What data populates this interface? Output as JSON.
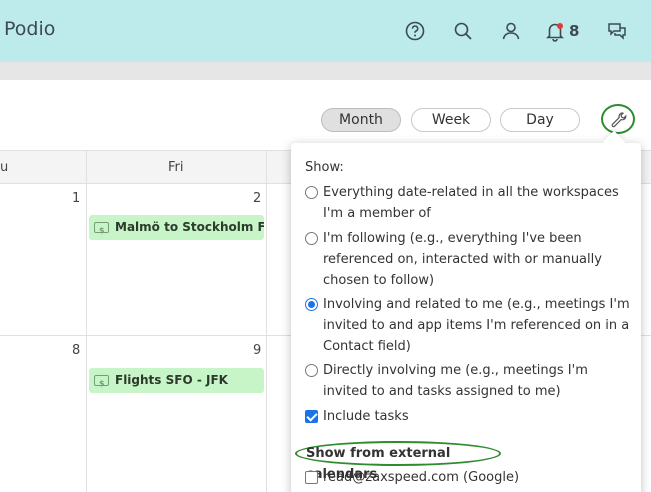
{
  "app": {
    "brand": "Podio"
  },
  "topbar": {
    "icons": [
      "help-icon",
      "search-icon",
      "profile-icon",
      "bell-icon",
      "chat-icon"
    ],
    "notification_count": "8"
  },
  "views": {
    "month": "Month",
    "week": "Week",
    "day": "Day",
    "active": "Month"
  },
  "calendar": {
    "days": [
      "u",
      "Fri"
    ],
    "week1": {
      "thu_date": "1",
      "fri_date": "2",
      "event": "Malmö to Stockholm Fligh"
    },
    "week2": {
      "thu_date": "8",
      "fri_date": "9",
      "event": "Flights SFO - JFK"
    }
  },
  "settings": {
    "show_label": "Show:",
    "options": [
      {
        "label": "Everything date-related in all the workspaces I'm a member of",
        "checked": false
      },
      {
        "label": "I'm following (e.g., everything I've been referenced on, interacted with or manually chosen to follow)",
        "checked": false
      },
      {
        "label": "Involving and related to me (e.g., meetings I'm invited to and app items I'm referenced on in a Contact field)",
        "checked": true
      },
      {
        "label": "Directly involving me (e.g., meetings I'm invited to and tasks assigned to me)",
        "checked": false
      }
    ],
    "include_tasks": "Include tasks",
    "external_title": "Show from external calendars",
    "external_item": "read@zaxspeed.com (Google)"
  },
  "colors": {
    "topbar": "#bdeaea",
    "event": "#c8f5c8",
    "accent": "#1a73e8",
    "highlight": "#2e8b2e"
  }
}
